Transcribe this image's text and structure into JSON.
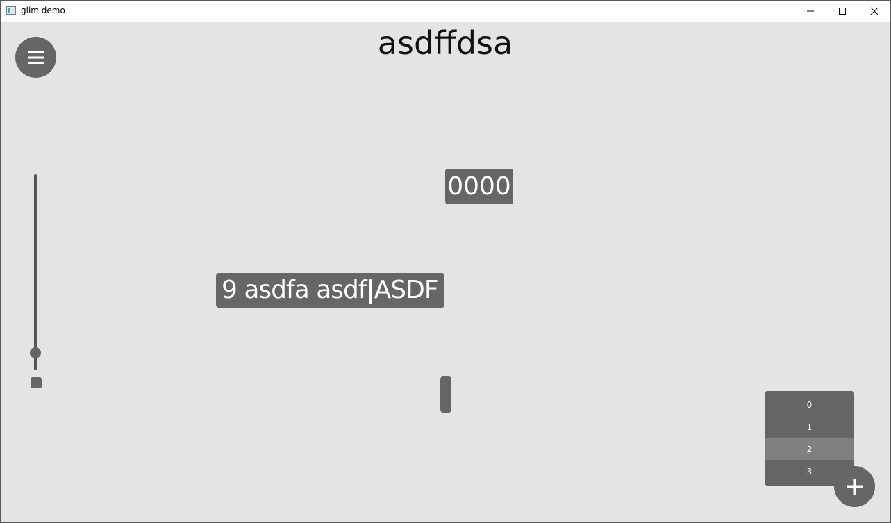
{
  "window": {
    "title": "glim demo"
  },
  "page": {
    "title": "asdffdsa"
  },
  "counter": {
    "value": "0000"
  },
  "text_input": {
    "value": "9 asdfa asdf|ASDF"
  },
  "slider": {
    "value_fraction": 0.08
  },
  "dropdown": {
    "items": [
      "0",
      "1",
      "2",
      "3"
    ],
    "selected_index": 2
  },
  "colors": {
    "background": "#e4e4e4",
    "control": "#666666",
    "selected": "#808080",
    "titlebar": "#ffffff"
  },
  "icons": {
    "menu": "hamburger-icon",
    "add": "plus-icon",
    "minimize": "minimize-icon",
    "maximize": "maximize-icon",
    "close": "close-icon"
  }
}
